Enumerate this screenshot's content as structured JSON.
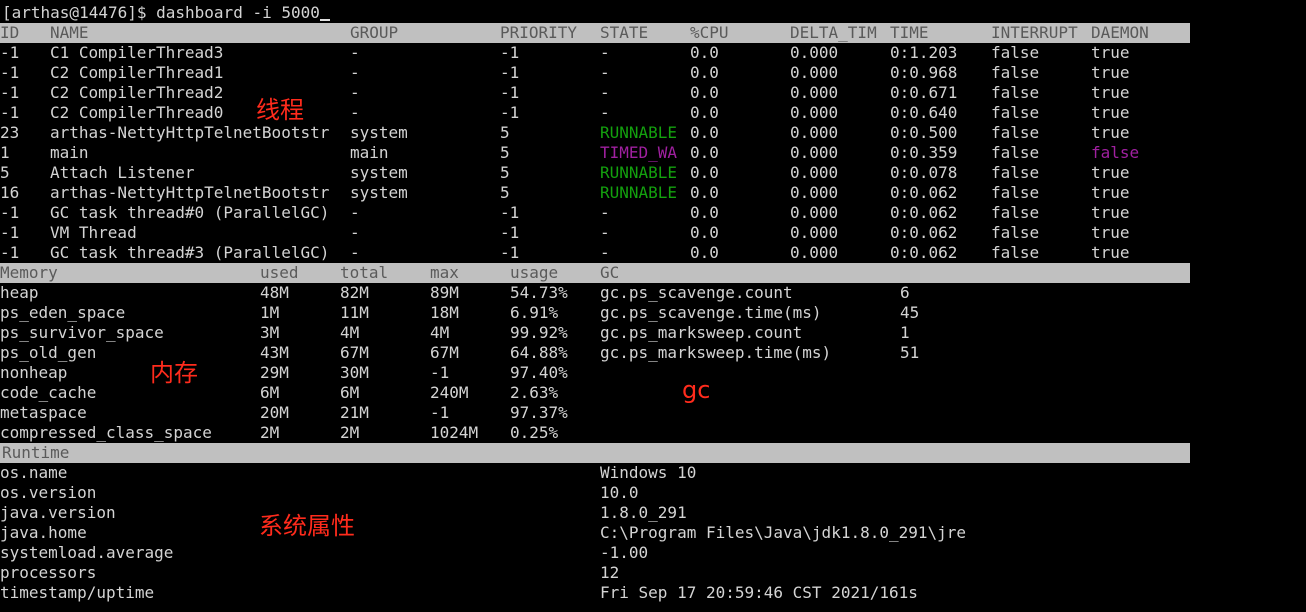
{
  "prompt": "[arthas@14476]$ dashboard -i 5000",
  "thread_headers": [
    "ID",
    "NAME",
    "GROUP",
    "PRIORITY",
    "STATE",
    "%CPU",
    "DELTA_TIM",
    "TIME",
    "INTERRUPT",
    "DAEMON"
  ],
  "threads": [
    {
      "id": "-1",
      "name": "C1 CompilerThread3",
      "group": "-",
      "priority": "-1",
      "state": "-",
      "cpu": "0.0",
      "delta": "0.000",
      "time": "0:1.203",
      "interrupt": "false",
      "daemon": "true",
      "state_color": "",
      "daemon_color": ""
    },
    {
      "id": "-1",
      "name": "C2 CompilerThread1",
      "group": "-",
      "priority": "-1",
      "state": "-",
      "cpu": "0.0",
      "delta": "0.000",
      "time": "0:0.968",
      "interrupt": "false",
      "daemon": "true",
      "state_color": "",
      "daemon_color": ""
    },
    {
      "id": "-1",
      "name": "C2 CompilerThread2",
      "group": "-",
      "priority": "-1",
      "state": "-",
      "cpu": "0.0",
      "delta": "0.000",
      "time": "0:0.671",
      "interrupt": "false",
      "daemon": "true",
      "state_color": "",
      "daemon_color": ""
    },
    {
      "id": "-1",
      "name": "C2 CompilerThread0",
      "group": "-",
      "priority": "-1",
      "state": "-",
      "cpu": "0.0",
      "delta": "0.000",
      "time": "0:0.640",
      "interrupt": "false",
      "daemon": "true",
      "state_color": "",
      "daemon_color": ""
    },
    {
      "id": "23",
      "name": "arthas-NettyHttpTelnetBootstr",
      "group": "system",
      "priority": "5",
      "state": "RUNNABLE",
      "cpu": "0.0",
      "delta": "0.000",
      "time": "0:0.500",
      "interrupt": "false",
      "daemon": "true",
      "state_color": "#13a10e",
      "daemon_color": ""
    },
    {
      "id": "1",
      "name": "main",
      "group": "main",
      "priority": "5",
      "state": "TIMED_WA",
      "cpu": "0.0",
      "delta": "0.000",
      "time": "0:0.359",
      "interrupt": "false",
      "daemon": "false",
      "state_color": "#a020a0",
      "daemon_color": "#a020a0"
    },
    {
      "id": "5",
      "name": "Attach Listener",
      "group": "system",
      "priority": "5",
      "state": "RUNNABLE",
      "cpu": "0.0",
      "delta": "0.000",
      "time": "0:0.078",
      "interrupt": "false",
      "daemon": "true",
      "state_color": "#13a10e",
      "daemon_color": ""
    },
    {
      "id": "16",
      "name": "arthas-NettyHttpTelnetBootstr",
      "group": "system",
      "priority": "5",
      "state": "RUNNABLE",
      "cpu": "0.0",
      "delta": "0.000",
      "time": "0:0.062",
      "interrupt": "false",
      "daemon": "true",
      "state_color": "#13a10e",
      "daemon_color": ""
    },
    {
      "id": "-1",
      "name": "GC task thread#0 (ParallelGC)",
      "group": "-",
      "priority": "-1",
      "state": "-",
      "cpu": "0.0",
      "delta": "0.000",
      "time": "0:0.062",
      "interrupt": "false",
      "daemon": "true",
      "state_color": "",
      "daemon_color": ""
    },
    {
      "id": "-1",
      "name": "VM Thread",
      "group": "-",
      "priority": "-1",
      "state": "-",
      "cpu": "0.0",
      "delta": "0.000",
      "time": "0:0.062",
      "interrupt": "false",
      "daemon": "true",
      "state_color": "",
      "daemon_color": ""
    },
    {
      "id": "-1",
      "name": "GC task thread#3 (ParallelGC)",
      "group": "-",
      "priority": "-1",
      "state": "-",
      "cpu": "0.0",
      "delta": "0.000",
      "time": "0:0.062",
      "interrupt": "false",
      "daemon": "true",
      "state_color": "",
      "daemon_color": ""
    }
  ],
  "memory_headers": [
    "Memory",
    "used",
    "total",
    "max",
    "usage",
    "GC"
  ],
  "memory": [
    {
      "name": "heap",
      "used": "48M",
      "total": "82M",
      "max": "89M",
      "usage": "54.73%"
    },
    {
      "name": "ps_eden_space",
      "used": "1M",
      "total": "11M",
      "max": "18M",
      "usage": "6.91%"
    },
    {
      "name": "ps_survivor_space",
      "used": "3M",
      "total": "4M",
      "max": "4M",
      "usage": "99.92%"
    },
    {
      "name": "ps_old_gen",
      "used": "43M",
      "total": "67M",
      "max": "67M",
      "usage": "64.88%"
    },
    {
      "name": "nonheap",
      "used": "29M",
      "total": "30M",
      "max": "-1",
      "usage": "97.40%"
    },
    {
      "name": "code_cache",
      "used": "6M",
      "total": "6M",
      "max": "240M",
      "usage": "2.63%"
    },
    {
      "name": "metaspace",
      "used": "20M",
      "total": "21M",
      "max": "-1",
      "usage": "97.37%"
    },
    {
      "name": "compressed_class_space",
      "used": "2M",
      "total": "2M",
      "max": "1024M",
      "usage": "0.25%"
    }
  ],
  "gc": [
    {
      "name": "gc.ps_scavenge.count",
      "value": "6"
    },
    {
      "name": "gc.ps_scavenge.time(ms)",
      "value": "45"
    },
    {
      "name": "gc.ps_marksweep.count",
      "value": "1"
    },
    {
      "name": "gc.ps_marksweep.time(ms)",
      "value": "51"
    }
  ],
  "runtime_header": "Runtime",
  "runtime": [
    {
      "name": "os.name",
      "value": "Windows 10"
    },
    {
      "name": "os.version",
      "value": "10.0"
    },
    {
      "name": "java.version",
      "value": "1.8.0_291"
    },
    {
      "name": "java.home",
      "value": "C:\\Program Files\\Java\\jdk1.8.0_291\\jre"
    },
    {
      "name": "systemload.average",
      "value": "-1.00"
    },
    {
      "name": "processors",
      "value": "12"
    },
    {
      "name": "timestamp/uptime",
      "value": "Fri Sep 17 20:59:46 CST 2021/161s"
    }
  ],
  "annotations": {
    "threads": "线程",
    "memory": "内存",
    "gc": "gc",
    "runtime": "系统属性"
  },
  "colors": {
    "background": "#000000",
    "header_bar": "#c0c0c0",
    "header_text": "#5a5a5a",
    "text": "#d4d4d4",
    "runnable": "#13a10e",
    "timed_waiting": "#a020a0",
    "annotation": "#ff2b1c"
  }
}
